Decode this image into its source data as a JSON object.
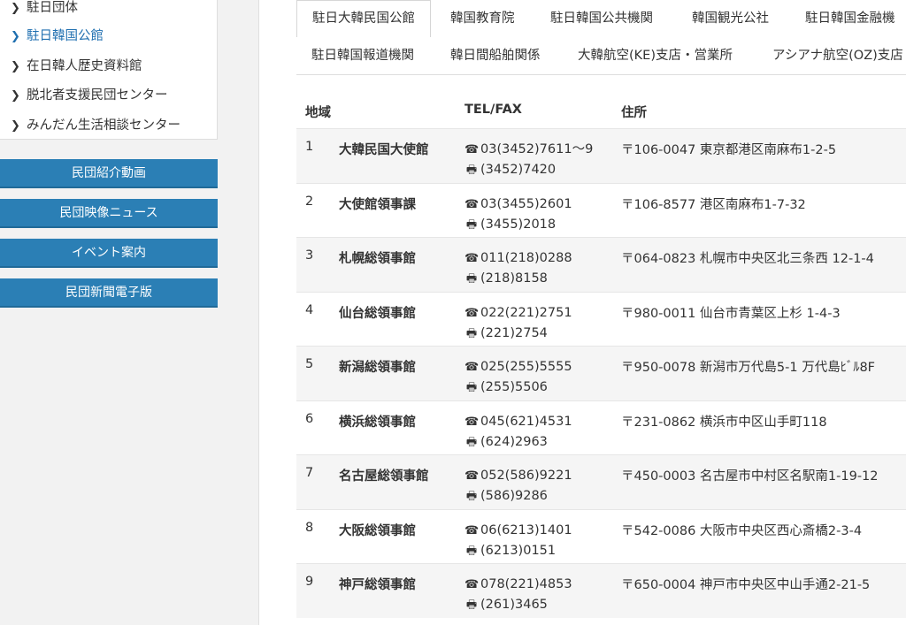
{
  "sidebar": {
    "sub_items": [
      {
        "label": "駐日団体",
        "active": false
      },
      {
        "label": "駐日韓国公館",
        "active": true
      },
      {
        "label": "在日韓人歴史資料館",
        "active": false
      },
      {
        "label": "脱北者支援民団センター",
        "active": false
      },
      {
        "label": "みんだん生活相談センター",
        "active": false
      }
    ],
    "buttons": [
      "民団紹介動画",
      "民団映像ニュース",
      "イベント案内",
      "民団新聞電子版"
    ]
  },
  "tabs": {
    "row1": [
      "駐日大韓民国公館",
      "韓国教育院",
      "駐日韓国公共機関",
      "韓国観光公社",
      "駐日韓国金融機"
    ],
    "row2": [
      "駐日韓国報道機関",
      "韓日間船舶関係",
      "大韓航空(KE)支店・営業所",
      "アシアナ航空(OZ)支店"
    ]
  },
  "table": {
    "headers": {
      "region": "地域",
      "telfax": "TEL/FAX",
      "address": "住所"
    },
    "rows": [
      {
        "num": "1",
        "name": "大韓民国大使館",
        "tel": "03(3452)7611～9",
        "fax": "(3452)7420",
        "address": "〒106-0047 東京都港区南麻布1-2-5"
      },
      {
        "num": "2",
        "name": "大使館領事課",
        "tel": "03(3455)2601",
        "fax": "(3455)2018",
        "address": "〒106-8577 港区南麻布1-7-32"
      },
      {
        "num": "3",
        "name": "札幌総領事館",
        "tel": "011(218)0288",
        "fax": "(218)8158",
        "address": "〒064-0823 札幌市中央区北三条西 12-1-4"
      },
      {
        "num": "4",
        "name": "仙台総領事館",
        "tel": "022(221)2751",
        "fax": "(221)2754",
        "address": "〒980-0011 仙台市青葉区上杉 1-4-3"
      },
      {
        "num": "5",
        "name": "新潟総領事館",
        "tel": "025(255)5555",
        "fax": "(255)5506",
        "address": "〒950-0078 新潟市万代島5-1 万代島ﾋﾞﾙ8F"
      },
      {
        "num": "6",
        "name": "横浜総領事館",
        "tel": "045(621)4531",
        "fax": "(624)2963",
        "address": "〒231-0862 横浜市中区山手町118"
      },
      {
        "num": "7",
        "name": "名古屋総領事館",
        "tel": "052(586)9221",
        "fax": "(586)9286",
        "address": "〒450-0003 名古屋市中村区名駅南1-19-12"
      },
      {
        "num": "8",
        "name": "大阪総領事館",
        "tel": "06(6213)1401",
        "fax": "(6213)0151",
        "address": "〒542-0086 大阪市中央区西心斎橋2-3-4"
      },
      {
        "num": "9",
        "name": "神戸総領事館",
        "tel": "078(221)4853",
        "fax": "(261)3465",
        "address": "〒650-0004 神戸市中央区中山手通2-21-5"
      }
    ]
  },
  "icons": {
    "tel": "phone-icon",
    "fax": "fax-icon",
    "chevron": "chevron-right-icon"
  },
  "colors": {
    "accent": "#2b7fb5",
    "active_link": "#1f6fb0",
    "row_alt": "#f5f5f5"
  }
}
